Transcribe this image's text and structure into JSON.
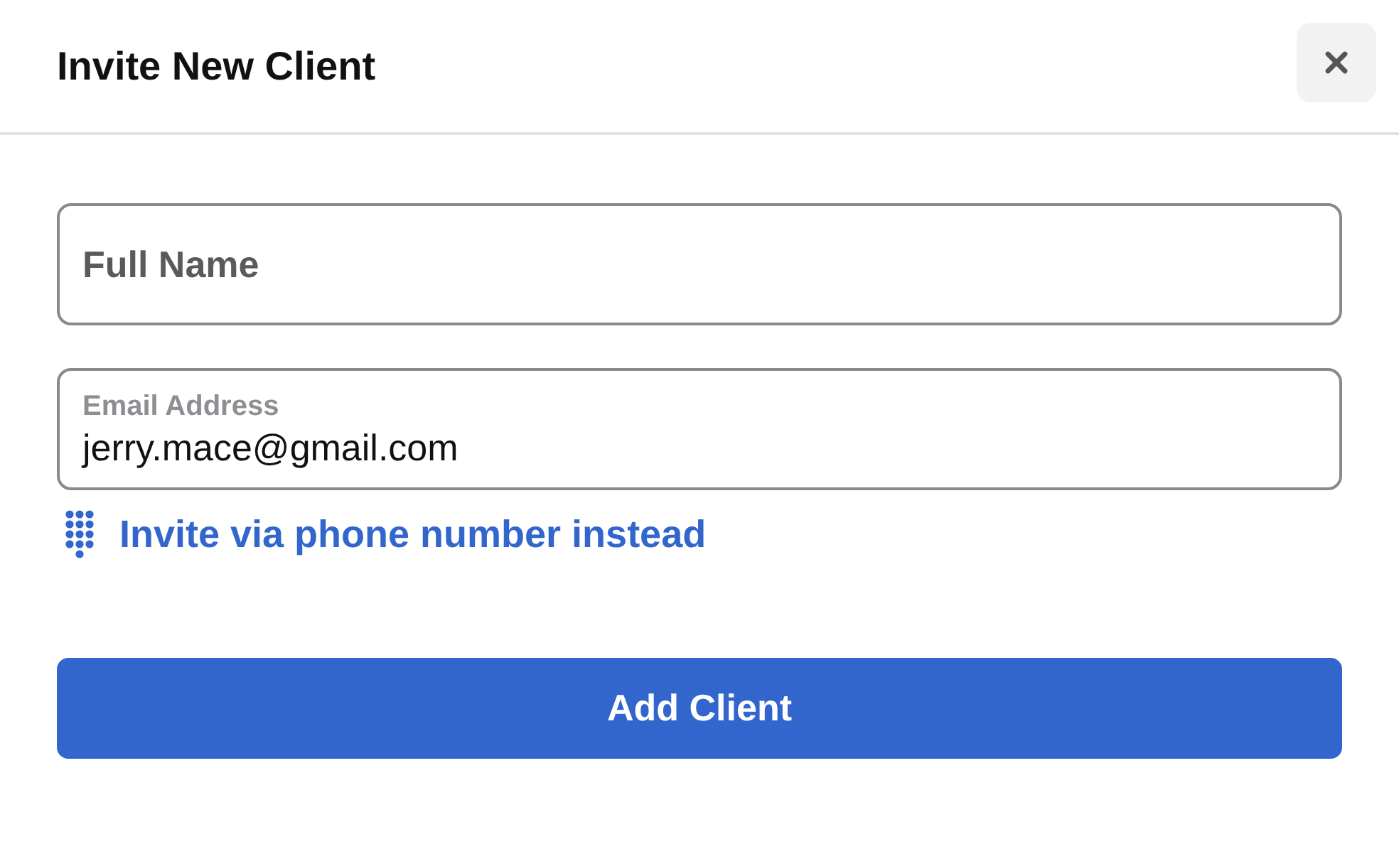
{
  "dialog": {
    "title": "Invite New Client"
  },
  "fields": [
    {
      "placeholder": "Full Name"
    },
    {
      "label": "Email Address",
      "value": "jerry.mace@gmail.com"
    }
  ],
  "phone_link": "Invite via phone number instead",
  "submit_button": "Add Client"
}
